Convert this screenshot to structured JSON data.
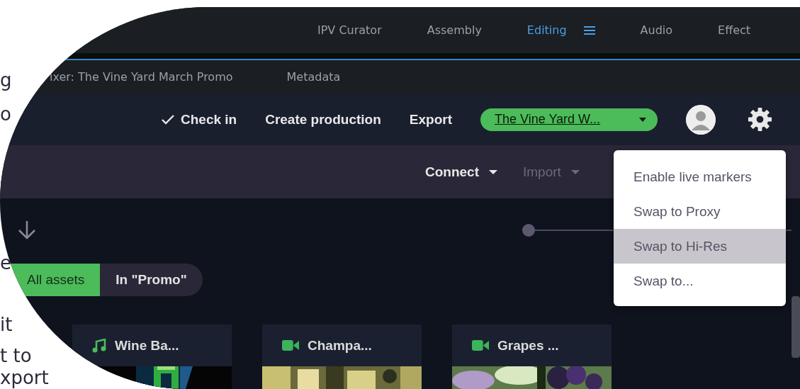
{
  "page_fragments": [
    "g",
    "o",
    "e",
    "it",
    "t to",
    "xport"
  ],
  "workspace_tabs": [
    {
      "label": "IPV Curator",
      "selected": false
    },
    {
      "label": "Assembly",
      "selected": false
    },
    {
      "label": "Editing",
      "selected": true
    },
    {
      "label": "Audio",
      "selected": false
    },
    {
      "label": "Effect",
      "selected": false
    }
  ],
  "panel_tabs": [
    "ixer: The Vine Yard March Promo",
    "Metadata"
  ],
  "header": {
    "check_in": "Check in",
    "actions": [
      "Create production",
      "Export"
    ],
    "production": "The Vine Yard W..."
  },
  "toolbar": [
    {
      "label": "Connect",
      "disabled": false
    },
    {
      "label": "Import",
      "disabled": true
    }
  ],
  "slider": {
    "level": 0
  },
  "filter": [
    {
      "label": "All assets",
      "selected": true
    },
    {
      "label": "In \"Promo\"",
      "selected": false
    }
  ],
  "assets": [
    {
      "kind": "audio",
      "name": "Wine Ba..."
    },
    {
      "kind": "video",
      "name": "Champa..."
    },
    {
      "kind": "video",
      "name": "Grapes ..."
    }
  ],
  "menu": [
    {
      "label": "Enable live markers",
      "selected": false
    },
    {
      "label": "Swap to Proxy",
      "selected": false
    },
    {
      "label": "Swap to Hi-Res",
      "selected": true
    },
    {
      "label": "Swap to...",
      "selected": false
    }
  ]
}
